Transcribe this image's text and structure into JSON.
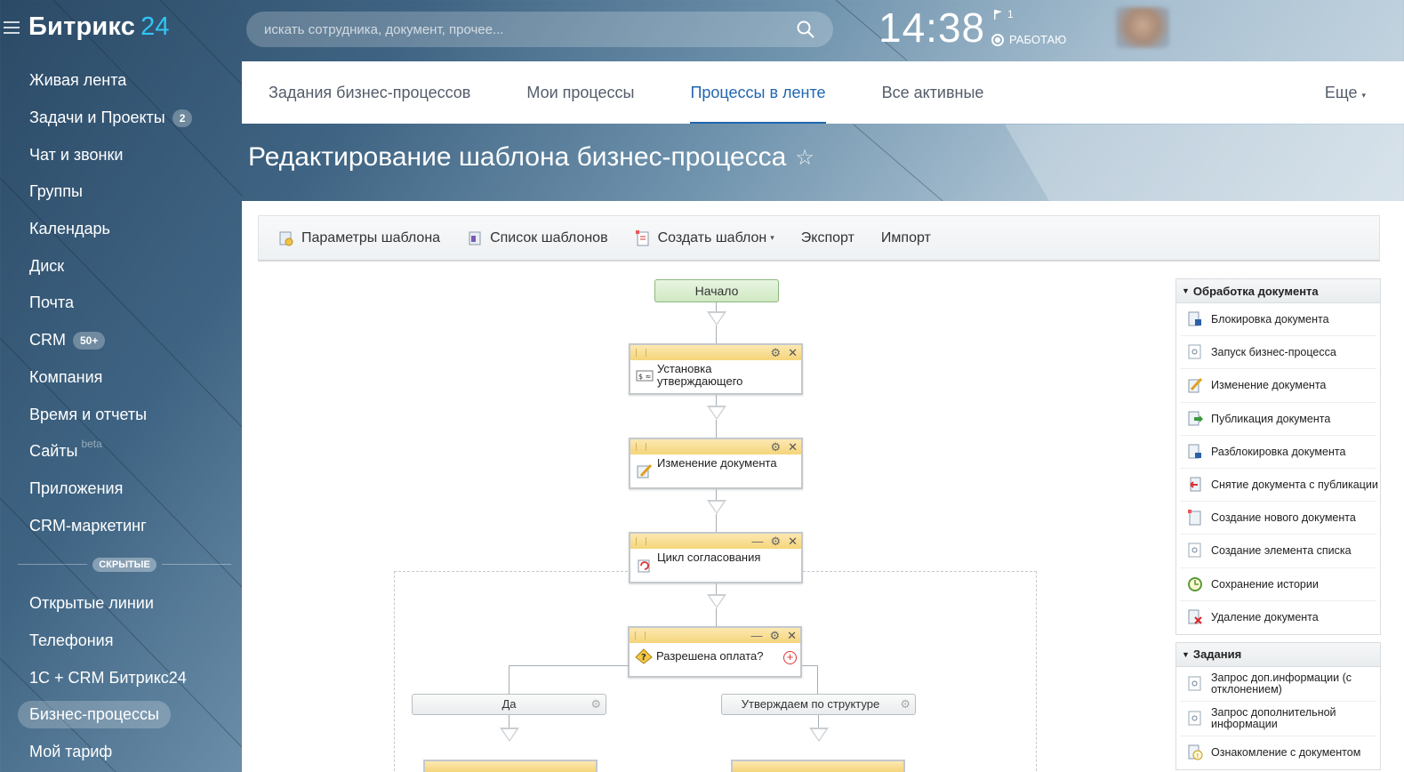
{
  "app": {
    "logo_text": "Битрикс",
    "logo_num": "24"
  },
  "sidebar": {
    "items": [
      {
        "label": "Живая лента"
      },
      {
        "label": "Задачи и Проекты",
        "badge": "2"
      },
      {
        "label": "Чат и звонки"
      },
      {
        "label": "Группы"
      },
      {
        "label": "Календарь"
      },
      {
        "label": "Диск"
      },
      {
        "label": "Почта"
      },
      {
        "label": "CRM",
        "badge": "50+"
      },
      {
        "label": "Компания"
      },
      {
        "label": "Время и отчеты"
      },
      {
        "label": "Сайты",
        "tag": "beta"
      },
      {
        "label": "Приложения"
      },
      {
        "label": "CRM-маркетинг"
      }
    ],
    "hidden_label": "СКРЫТЫЕ",
    "hidden_items": [
      {
        "label": "Открытые линии"
      },
      {
        "label": "Телефония"
      },
      {
        "label": "1С + CRM Битрикс24"
      },
      {
        "label": "Бизнес-процессы",
        "active": true
      },
      {
        "label": "Мой тариф"
      }
    ]
  },
  "header": {
    "search_placeholder": "искать сотрудника, документ, прочее...",
    "clock": "14:38",
    "flag_count": "1",
    "status": "РАБОТАЮ"
  },
  "tabs": {
    "items": [
      "Задания бизнес-процессов",
      "Мои процессы",
      "Процессы в ленте",
      "Все активные"
    ],
    "active_index": 2,
    "more": "Еще"
  },
  "page": {
    "title": "Редактирование шаблона бизнес-процесса",
    "star": "☆"
  },
  "toolbar": {
    "template_params": "Параметры шаблона",
    "template_list": "Список шаблонов",
    "create_template": "Создать шаблон",
    "export": "Экспорт",
    "import": "Импорт"
  },
  "designer": {
    "start": "Начало",
    "blocks": [
      {
        "label": "Установка утверждающего"
      },
      {
        "label": "Изменение документа"
      },
      {
        "label": "Цикл согласования"
      },
      {
        "label": "Разрешена оплата?"
      }
    ],
    "branch_yes": "Да",
    "branch_other": "Утверждаем по структуре компании"
  },
  "palette": {
    "sections": [
      {
        "title": "Обработка документа",
        "items": [
          {
            "label": "Блокировка документа",
            "icon": "lock-document-icon"
          },
          {
            "label": "Запуск бизнес-процесса",
            "icon": "start-process-icon"
          },
          {
            "label": "Изменение документа",
            "icon": "edit-document-icon"
          },
          {
            "label": "Публикация документа",
            "icon": "publish-document-icon"
          },
          {
            "label": "Разблокировка документа",
            "icon": "unlock-document-icon"
          },
          {
            "label": "Снятие документа с публикации",
            "icon": "unpublish-document-icon"
          },
          {
            "label": "Создание нового документа",
            "icon": "new-document-icon"
          },
          {
            "label": "Создание элемента списка",
            "icon": "list-element-icon"
          },
          {
            "label": "Сохранение истории",
            "icon": "history-clock-icon"
          },
          {
            "label": "Удаление документа",
            "icon": "delete-document-icon"
          }
        ]
      },
      {
        "title": "Задания",
        "items": [
          {
            "label": "Запрос доп.информации (с отклонением)",
            "icon": "request-info-reject-icon"
          },
          {
            "label": "Запрос дополнительной информации",
            "icon": "request-info-icon"
          },
          {
            "label": "Ознакомление с документом",
            "icon": "review-document-icon"
          }
        ]
      }
    ]
  },
  "colors": {
    "accent": "#2067b0",
    "logo_num": "#2fc6f6",
    "block_head": "#f5d57a",
    "start_node": "#cfe9c2"
  }
}
